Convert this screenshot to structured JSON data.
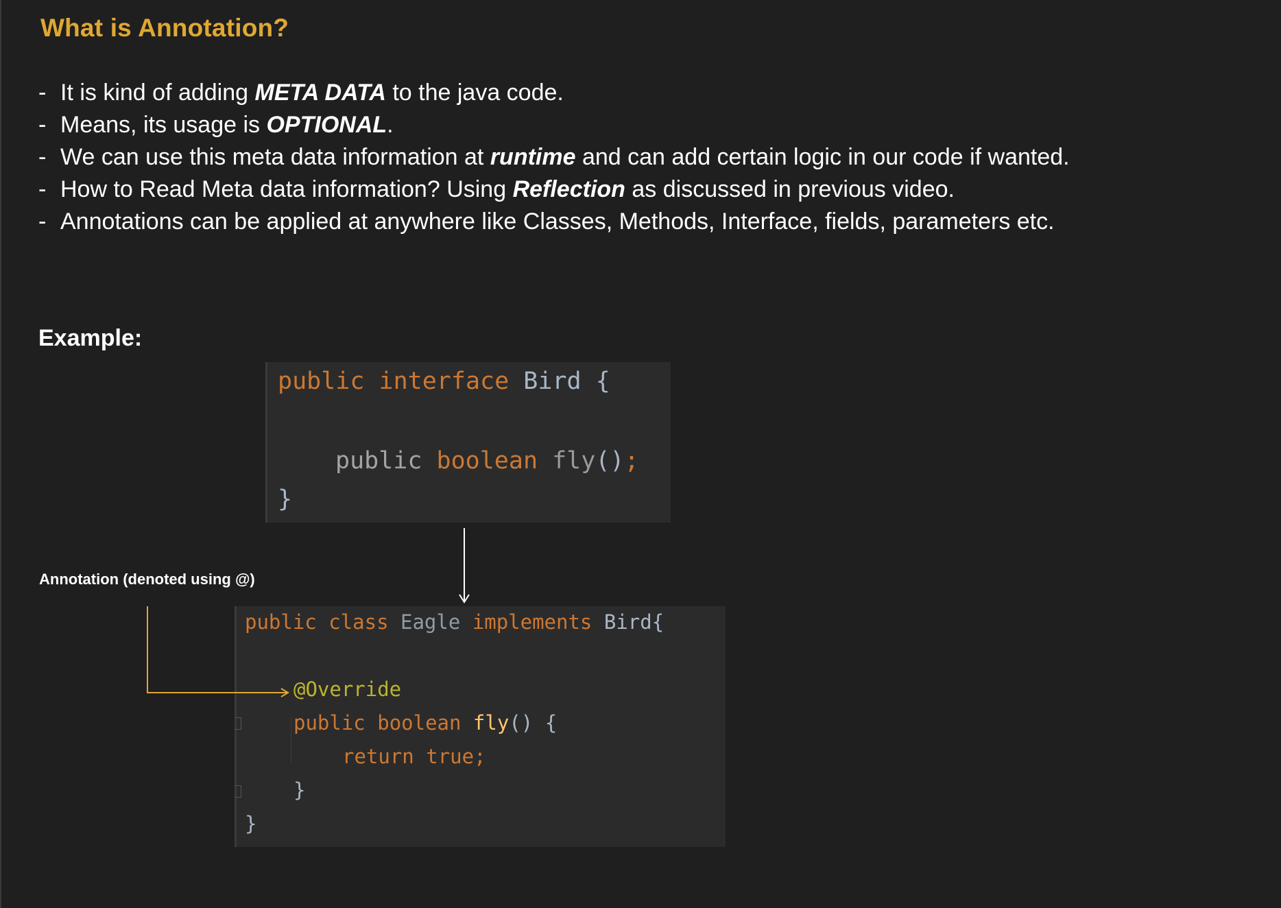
{
  "slide": {
    "title": "What is Annotation?",
    "bullets": [
      {
        "dash": "-",
        "parts": [
          "It is kind of adding ",
          "META DATA",
          " to the java code."
        ]
      },
      {
        "dash": "-",
        "parts": [
          "Means, its usage is ",
          "OPTIONAL",
          "."
        ]
      },
      {
        "dash": "-",
        "parts": [
          "We can use this meta data information at ",
          "runtime",
          " and can add certain logic in our code if wanted."
        ]
      },
      {
        "dash": "-",
        "parts": [
          "How to Read Meta data information? Using ",
          "Reflection",
          " as discussed in previous video."
        ]
      },
      {
        "dash": "-",
        "parts": [
          "Annotations can be applied at anywhere like Classes, Methods, Interface, fields, parameters etc.",
          "",
          ""
        ]
      }
    ],
    "example_label": "Example:",
    "annotation_label": "Annotation (denoted using @)"
  },
  "code_interface": {
    "line1": {
      "kw1": "public",
      "kw2": "interface",
      "name": "Bird",
      "brace": "{"
    },
    "line2": {
      "kw1": "public",
      "kw2": "boolean",
      "fn": "fly",
      "parens": "()",
      "semi": ";"
    },
    "line3": {
      "brace": "}"
    }
  },
  "code_class": {
    "line1": {
      "kw1": "public",
      "kw2": "class",
      "name": "Eagle",
      "kw3": "implements",
      "iface": "Bird{"
    },
    "line2": {
      "annotation": "@Override"
    },
    "line3": {
      "kw1": "public",
      "kw2": "boolean",
      "fn": "fly",
      "rest": "() {"
    },
    "line4": {
      "kw": "return",
      "val": "true;"
    },
    "line5": {
      "brace": "}"
    },
    "line6": {
      "brace": "}"
    }
  },
  "colors": {
    "background": "#1f1f1f",
    "title": "#e0a832",
    "arrow_annotation": "#e0a832",
    "arrow_down": "#ffffff",
    "code_bg": "#2b2b2c"
  }
}
